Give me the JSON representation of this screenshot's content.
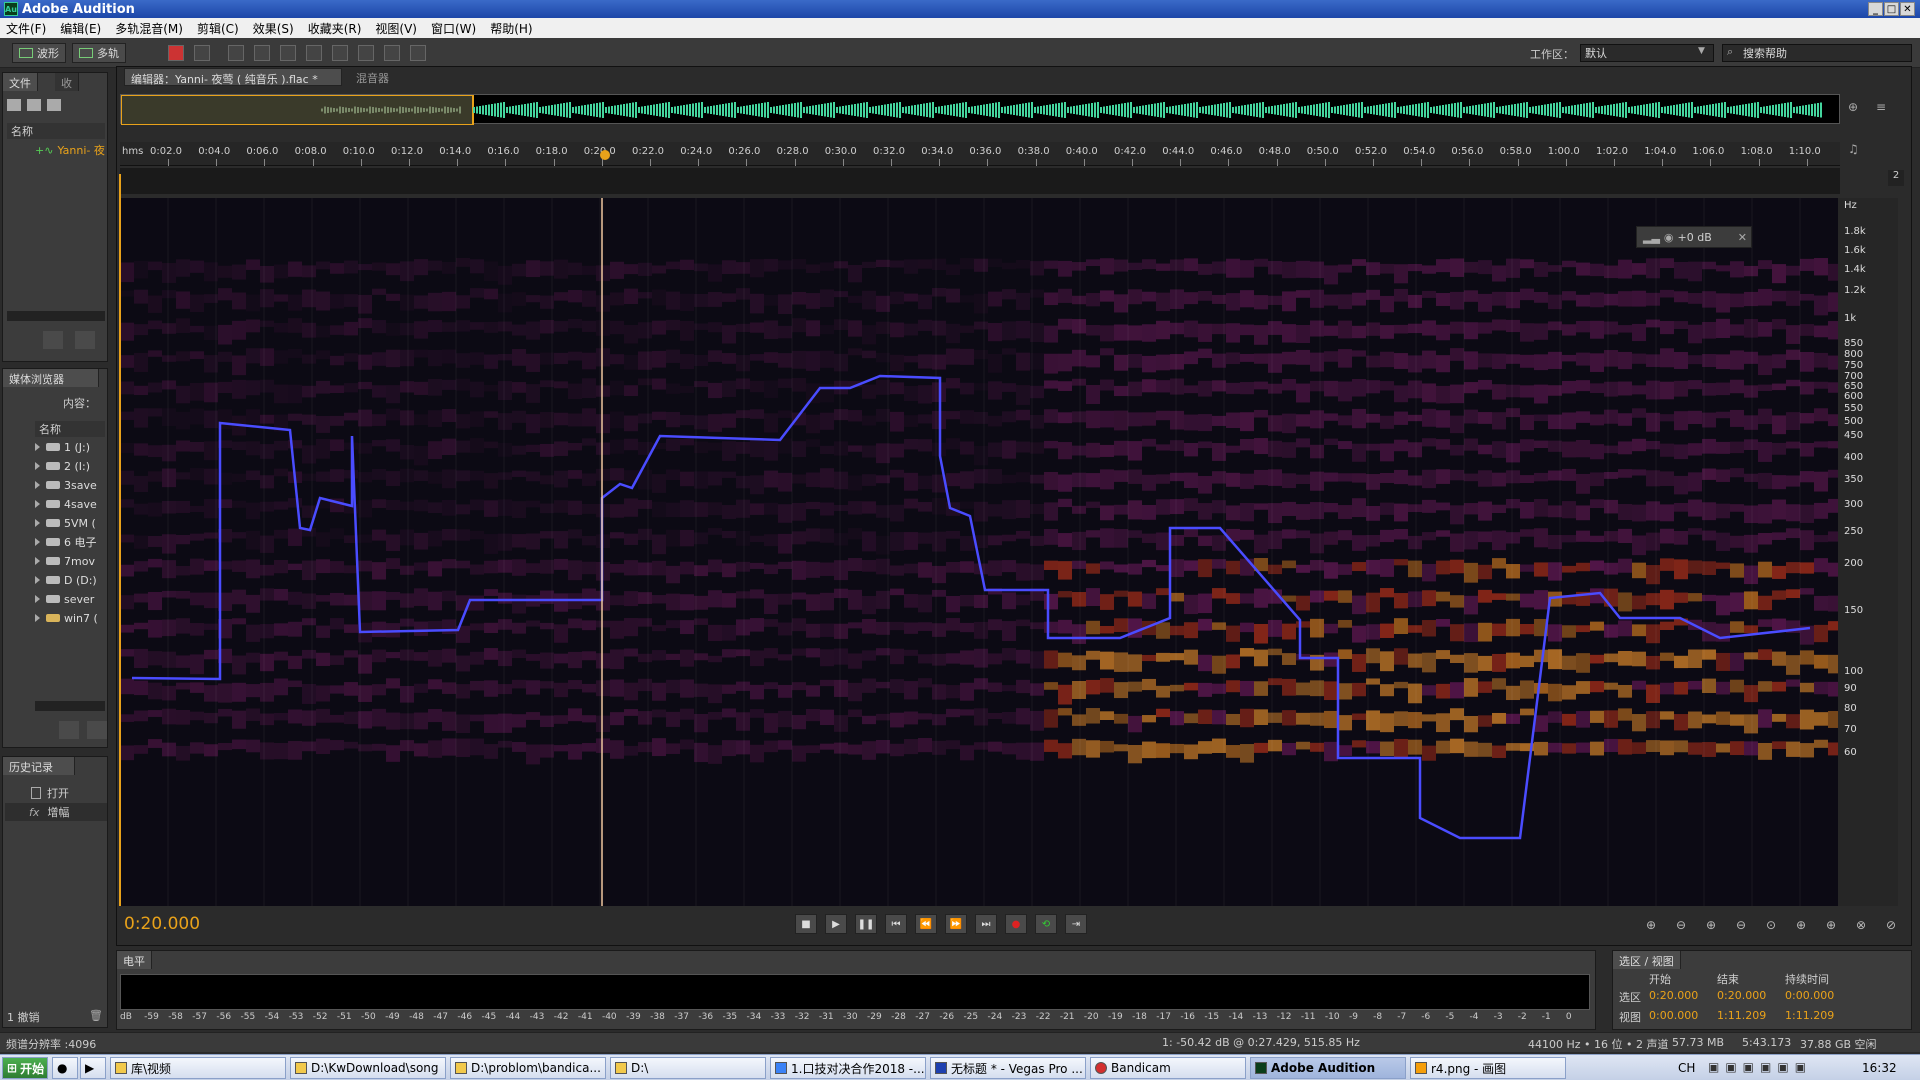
{
  "window": {
    "title": "Adobe Audition",
    "logo": "Au"
  },
  "menu": [
    "文件(F)",
    "编辑(E)",
    "多轨混音(M)",
    "剪辑(C)",
    "效果(S)",
    "收藏夹(R)",
    "视图(V)",
    "窗口(W)",
    "帮助(H)"
  ],
  "toolbar": {
    "waveform_label": "波形",
    "multitrack_label": "多轨",
    "workspace_label": "工作区：",
    "workspace_value": "默认",
    "help_placeholder": "搜索帮助"
  },
  "files_panel": {
    "tab_files": "文件",
    "tab_fav": "收",
    "col_name": "名称",
    "file_item": "Yanni- 夜"
  },
  "media_panel": {
    "tab": "媒体浏览器",
    "content_label": "内容：",
    "col_name": "名称",
    "items": [
      "1 (J:)",
      "2 (I:)",
      "3save",
      "4save",
      "5VM (",
      "6 电子",
      "7mov",
      "D (D:)",
      "sever",
      "win7 ("
    ]
  },
  "history_panel": {
    "tab": "历史记录",
    "items": [
      "打开",
      "增幅"
    ],
    "undo_count": "1 撤销"
  },
  "editor": {
    "tab_label": "编辑器：Yanni- 夜莺 ( 纯音乐 ).flac *",
    "mixer_tab": "混音器",
    "time_unit": "hms",
    "current_time": "0:20.000",
    "gain_label": "+0 dB",
    "channel_num": "2"
  },
  "ruler_ticks": [
    "0:02.0",
    "0:04.0",
    "0:06.0",
    "0:08.0",
    "0:10.0",
    "0:12.0",
    "0:14.0",
    "0:16.0",
    "0:18.0",
    "0:20.0",
    "0:22.0",
    "0:24.0",
    "0:26.0",
    "0:28.0",
    "0:30.0",
    "0:32.0",
    "0:34.0",
    "0:36.0",
    "0:38.0",
    "0:40.0",
    "0:42.0",
    "0:44.0",
    "0:46.0",
    "0:48.0",
    "0:50.0",
    "0:52.0",
    "0:54.0",
    "0:56.0",
    "0:58.0",
    "1:00.0",
    "1:02.0",
    "1:04.0",
    "1:06.0",
    "1:08.0",
    "1:10.0"
  ],
  "freq_axis": {
    "unit": "Hz",
    "labels": [
      "1.8k",
      "1.6k",
      "1.4k",
      "1.2k",
      "1k",
      "850",
      "800",
      "750",
      "700",
      "650",
      "600",
      "550",
      "500",
      "450",
      "400",
      "350",
      "300",
      "250",
      "200",
      "150",
      "100",
      "90",
      "80",
      "70",
      "60"
    ]
  },
  "level_panel": {
    "tab": "电平",
    "scale": [
      "dB",
      "-59",
      "-58",
      "-57",
      "-56",
      "-55",
      "-54",
      "-53",
      "-52",
      "-51",
      "-50",
      "-49",
      "-48",
      "-47",
      "-46",
      "-45",
      "-44",
      "-43",
      "-42",
      "-41",
      "-40",
      "-39",
      "-38",
      "-37",
      "-36",
      "-35",
      "-34",
      "-33",
      "-32",
      "-31",
      "-30",
      "-29",
      "-28",
      "-27",
      "-26",
      "-25",
      "-24",
      "-23",
      "-22",
      "-21",
      "-20",
      "-19",
      "-18",
      "-17",
      "-16",
      "-15",
      "-14",
      "-13",
      "-12",
      "-11",
      "-10",
      "-9",
      "-8",
      "-7",
      "-6",
      "-5",
      "-4",
      "-3",
      "-2",
      "-1",
      "0"
    ]
  },
  "selection_panel": {
    "tab": "选区 / 视图",
    "col_start": "开始",
    "col_end": "结束",
    "col_duration": "持续时间",
    "row_sel": "选区",
    "row_view": "视图",
    "sel_start": "0:20.000",
    "sel_end": "0:20.000",
    "sel_dur": "0:00.000",
    "view_start": "0:00.000",
    "view_end": "1:11.209",
    "view_dur": "1:11.209"
  },
  "status": {
    "fft": "频谱分辨率 :4096",
    "cursor": "1: -50.42 dB @ 0:27.429, 515.85 Hz",
    "format": "44100 Hz • 16 位 • 2 声道",
    "size": "57.73 MB",
    "duration": "5:43.173",
    "free": "37.88 GB 空闲"
  },
  "taskbar": {
    "start": "开始",
    "items": [
      "库\\视频",
      "D:\\KwDownload\\song",
      "D:\\problom\\bandica...",
      "D:\\",
      "1.口技对决合作2018 -...",
      "无标题 * - Vegas Pro ...",
      "Bandicam",
      "Adobe Audition",
      "r4.png - 画图"
    ],
    "lang": "CH",
    "clock": "16:32"
  }
}
